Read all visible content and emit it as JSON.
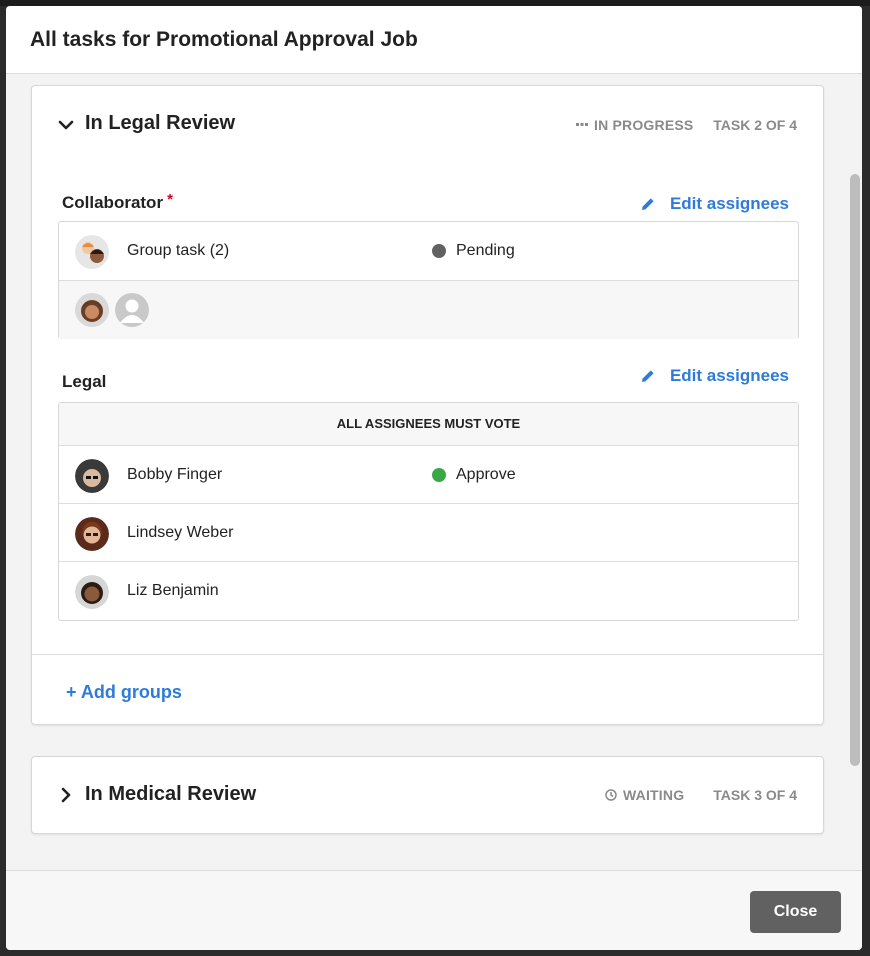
{
  "modal": {
    "title": "All tasks for Promotional Approval Job",
    "close_label": "Close"
  },
  "tasks": [
    {
      "title": "In Legal Review",
      "expanded": true,
      "status": "IN PROGRESS",
      "status_icon": "ellipsis-icon",
      "task_count": "TASK 2 OF 4",
      "groups": [
        {
          "label": "Collaborator",
          "required": true,
          "required_mark": "*",
          "edit_label": "Edit assignees",
          "rows": [
            {
              "name": "Group task (2)",
              "status": "Pending",
              "status_color": "#616161"
            }
          ]
        },
        {
          "label": "Legal",
          "edit_label": "Edit assignees",
          "vote_rule": "ALL ASSIGNEES MUST VOTE",
          "rows": [
            {
              "name": "Bobby Finger",
              "status": "Approve",
              "status_color": "#3aa847"
            },
            {
              "name": "Lindsey Weber"
            },
            {
              "name": "Liz Benjamin"
            }
          ]
        }
      ],
      "add_groups_label": "Add groups",
      "add_icon": "+"
    },
    {
      "title": "In Medical Review",
      "expanded": false,
      "status": "WAITING",
      "status_icon": "clock-icon",
      "task_count": "TASK 3 OF 4"
    }
  ]
}
